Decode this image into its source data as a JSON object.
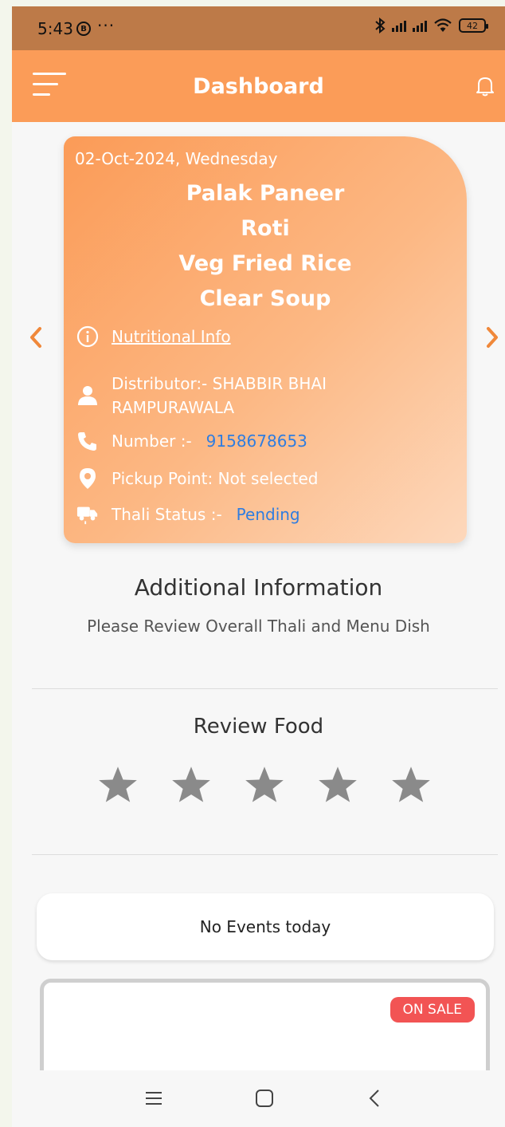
{
  "status_bar": {
    "time": "5:43",
    "badge": "B",
    "dots": "···",
    "battery": "42"
  },
  "header": {
    "title": "Dashboard"
  },
  "meal_card": {
    "date": "02-Oct-2024, Wednesday",
    "items": [
      "Palak Paneer",
      "Roti",
      "Veg Fried Rice",
      "Clear Soup"
    ],
    "nutrition_link": "Nutritional Info",
    "distributor": "Distributor:- SHABBIR BHAI RAMPURAWALA",
    "number_label": "Number :-",
    "number_value": "9158678653",
    "pickup": "Pickup Point: Not selected",
    "status_label": "Thali Status :-",
    "status_value": "Pending"
  },
  "additional": {
    "title": "Additional Information",
    "subtitle": "Please Review Overall Thali and Menu Dish"
  },
  "review": {
    "title": "Review Food",
    "rating": 0,
    "max": 5
  },
  "events": {
    "text": "No Events today"
  },
  "promo": {
    "badge": "ON SALE"
  },
  "colors": {
    "accent": "#fb9c58",
    "link": "#2f7de0",
    "sale": "#f25454",
    "star": "#8a8a8a"
  }
}
